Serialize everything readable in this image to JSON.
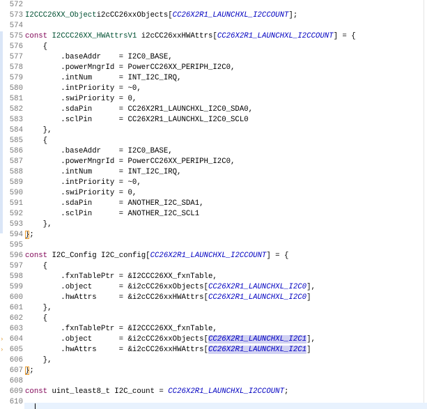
{
  "editor": {
    "lines": [
      {
        "num": "572",
        "tokens": []
      },
      {
        "num": "573",
        "tokens": [
          [
            "ty",
            "I2CCC26XX_Object"
          ],
          [
            "",
            "i2cCC26xxObjects["
          ],
          [
            "mac",
            "CC26X2R1_LAUNCHXL_I2CCOUNT"
          ],
          [
            "",
            "];"
          ]
        ]
      },
      {
        "num": "574",
        "tokens": []
      },
      {
        "num": "575",
        "tokens": [
          [
            "kw",
            "const"
          ],
          [
            "",
            " "
          ],
          [
            "ty",
            "I2CCC26XX_HWAttrsV1"
          ],
          [
            "",
            " i2cCC26xxHWAttrs["
          ],
          [
            "mac",
            "CC26X2R1_LAUNCHXL_I2CCOUNT"
          ],
          [
            "",
            "] = {"
          ]
        ]
      },
      {
        "num": "576",
        "tokens": [
          [
            "",
            "    {"
          ]
        ]
      },
      {
        "num": "577",
        "tokens": [
          [
            "",
            "        .baseAddr    = I2C0_BASE,"
          ]
        ]
      },
      {
        "num": "578",
        "tokens": [
          [
            "",
            "        .powerMngrId = PowerCC26XX_PERIPH_I2C0,"
          ]
        ]
      },
      {
        "num": "579",
        "tokens": [
          [
            "",
            "        .intNum      = INT_I2C_IRQ,"
          ]
        ]
      },
      {
        "num": "580",
        "tokens": [
          [
            "",
            "        .intPriority = ~0,"
          ]
        ]
      },
      {
        "num": "581",
        "tokens": [
          [
            "",
            "        .swiPriority = 0,"
          ]
        ]
      },
      {
        "num": "582",
        "tokens": [
          [
            "",
            "        .sdaPin      = CC26X2R1_LAUNCHXL_I2C0_SDA0,"
          ]
        ]
      },
      {
        "num": "583",
        "tokens": [
          [
            "",
            "        .sclPin      = CC26X2R1_LAUNCHXL_I2C0_SCL0"
          ]
        ]
      },
      {
        "num": "584",
        "tokens": [
          [
            "",
            "    },"
          ]
        ]
      },
      {
        "num": "585",
        "tokens": [
          [
            "",
            "    {"
          ]
        ]
      },
      {
        "num": "586",
        "tokens": [
          [
            "",
            "        .baseAddr    = I2C0_BASE,"
          ]
        ]
      },
      {
        "num": "587",
        "tokens": [
          [
            "",
            "        .powerMngrId = PowerCC26XX_PERIPH_I2C0,"
          ]
        ]
      },
      {
        "num": "588",
        "tokens": [
          [
            "",
            "        .intNum      = INT_I2C_IRQ,"
          ]
        ]
      },
      {
        "num": "589",
        "tokens": [
          [
            "",
            "        .intPriority = ~0,"
          ]
        ]
      },
      {
        "num": "590",
        "tokens": [
          [
            "",
            "        .swiPriority = 0,"
          ]
        ]
      },
      {
        "num": "591",
        "tokens": [
          [
            "",
            "        .sdaPin      = ANOTHER_I2C_SDA1,"
          ]
        ]
      },
      {
        "num": "592",
        "tokens": [
          [
            "",
            "        .sclPin      = ANOTHER_I2C_SCL1"
          ]
        ]
      },
      {
        "num": "593",
        "tokens": [
          [
            "",
            "    },"
          ]
        ]
      },
      {
        "num": "594",
        "tokens": [
          [
            "br",
            "}"
          ],
          [
            "",
            ";"
          ]
        ]
      },
      {
        "num": "595",
        "tokens": []
      },
      {
        "num": "596",
        "tokens": [
          [
            "kw",
            "const"
          ],
          [
            "",
            " I2C_Config I2C_config["
          ],
          [
            "mac",
            "CC26X2R1_LAUNCHXL_I2CCOUNT"
          ],
          [
            "",
            "] = {"
          ]
        ]
      },
      {
        "num": "597",
        "tokens": [
          [
            "",
            "    {"
          ]
        ]
      },
      {
        "num": "598",
        "tokens": [
          [
            "",
            "        .fxnTablePtr = &I2CCC26XX_fxnTable,"
          ]
        ]
      },
      {
        "num": "599",
        "tokens": [
          [
            "",
            "        .object      = &i2cCC26xxObjects["
          ],
          [
            "mac",
            "CC26X2R1_LAUNCHXL_I2C0"
          ],
          [
            "",
            "],"
          ]
        ]
      },
      {
        "num": "600",
        "tokens": [
          [
            "",
            "        .hwAttrs     = &i2cCC26xxHWAttrs["
          ],
          [
            "mac",
            "CC26X2R1_LAUNCHXL_I2C0"
          ],
          [
            "",
            "]"
          ]
        ]
      },
      {
        "num": "601",
        "tokens": [
          [
            "",
            "    },"
          ]
        ]
      },
      {
        "num": "602",
        "tokens": [
          [
            "",
            "    {"
          ]
        ]
      },
      {
        "num": "603",
        "tokens": [
          [
            "",
            "        .fxnTablePtr = &I2CCC26XX_fxnTable,"
          ]
        ]
      },
      {
        "num": "604",
        "marker": "›",
        "tokens": [
          [
            "",
            "        .object      = &i2cCC26xxObjects["
          ],
          [
            "mac hl",
            "CC26X2R1_LAUNCHXL_I2C1"
          ],
          [
            "",
            "],"
          ]
        ]
      },
      {
        "num": "605",
        "marker": "›",
        "tokens": [
          [
            "",
            "        .hwAttrs     = &i2cCC26xxHWAttrs["
          ],
          [
            "mac hl",
            "CC26X2R1_LAUNCHXL_I2C1"
          ],
          [
            "",
            "]"
          ]
        ]
      },
      {
        "num": "606",
        "tokens": [
          [
            "",
            "    },"
          ]
        ]
      },
      {
        "num": "607",
        "tokens": [
          [
            "br",
            "}"
          ],
          [
            "",
            ";"
          ]
        ]
      },
      {
        "num": "608",
        "tokens": []
      },
      {
        "num": "609",
        "tokens": [
          [
            "kw",
            "const"
          ],
          [
            "",
            " uint_least8_t I2C_count = "
          ],
          [
            "mac",
            "CC26X2R1_LAUNCHXL_I2CCOUNT"
          ],
          [
            "",
            ";"
          ]
        ]
      },
      {
        "num": "610",
        "tokens": []
      }
    ]
  }
}
